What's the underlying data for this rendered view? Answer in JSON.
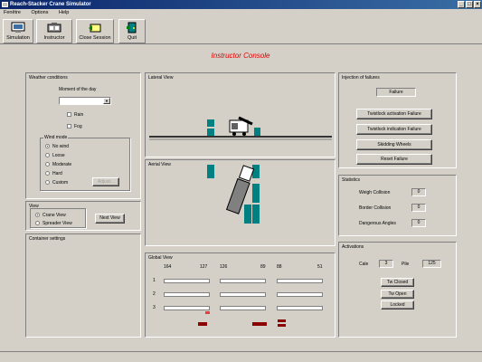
{
  "window": {
    "title": "Reach-Stacker Crane Simulator",
    "minimize": "_",
    "maximize": "□",
    "close": "×"
  },
  "menu": [
    {
      "label": "Fenêtre"
    },
    {
      "label": "Options"
    },
    {
      "label": "Help"
    }
  ],
  "toolbar": {
    "simulation": "Simulation",
    "instructor": "Instructor",
    "close_session": "Close Session",
    "quit": "Quit"
  },
  "console_title": "Instructor Console",
  "weather": {
    "title": "Weather conditions",
    "moment_label": "Moment of the day",
    "moment_value": "",
    "rain": "Rain",
    "fog": "Fog",
    "wind_title": "Wind mode",
    "wind_options": [
      "No wind",
      "Loose",
      "Moderate",
      "Hard",
      "Custom"
    ],
    "adjust": "Adjust..."
  },
  "view_panel": {
    "title": "View",
    "crane_view": "Crane View",
    "spreader_view": "Spreader View",
    "next_view": "Next View"
  },
  "container_settings": {
    "title": "Container settings"
  },
  "lateral_view": {
    "title": "Lateral View"
  },
  "aerial_view": {
    "title": "Aerial View"
  },
  "global_view": {
    "title": "Global View",
    "col_headers": [
      "164",
      "127",
      "126",
      "89",
      "88",
      "51"
    ],
    "row_labels": [
      "1",
      "2",
      "3"
    ]
  },
  "failures": {
    "title": "Injection of failures",
    "failure_field": "Failure",
    "buttons": [
      "Twistlock activation Failure",
      "Twistlock indication Failure",
      "Skidding Wheels",
      "Reset Failure"
    ]
  },
  "statistics": {
    "title": "Statistics",
    "rows": [
      {
        "label": "Weigh Collision",
        "value": "0"
      },
      {
        "label": "Border Collision",
        "value": "0"
      },
      {
        "label": "Dangerous Angles",
        "value": "0"
      }
    ]
  },
  "activation": {
    "title": "Activations",
    "cale_label": "Cale",
    "cale_value": "3",
    "pile_label": "Pile",
    "pile_value": "125",
    "buttons": [
      "Tw Closed",
      "Tw Open",
      "Locked"
    ]
  },
  "colors": {
    "titlebar": "#0a246a",
    "console_title": "#e00000",
    "container": "#008080",
    "marker": "#8b0000"
  }
}
